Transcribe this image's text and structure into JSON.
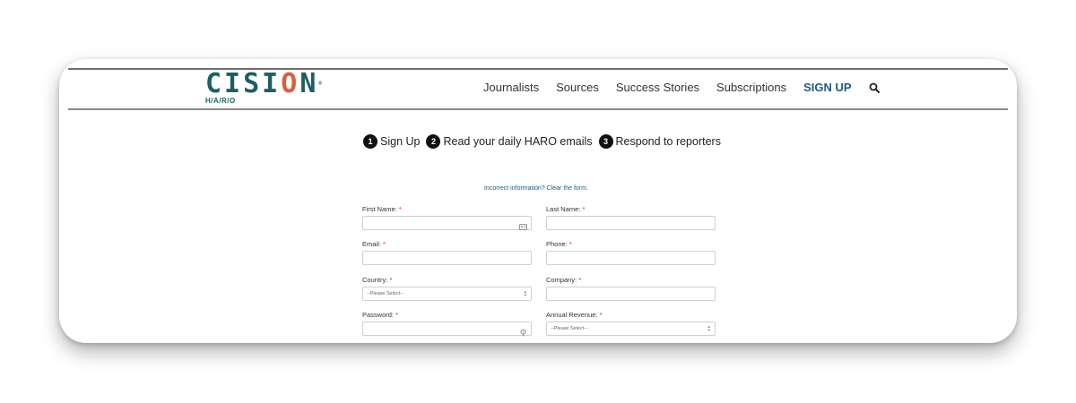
{
  "brand": {
    "word_start": "CISI",
    "word_o": "O",
    "word_end": "N",
    "trademark": "®",
    "subtitle": "H/A/R/O"
  },
  "nav": {
    "items": [
      "Journalists",
      "Sources",
      "Success Stories",
      "Subscriptions"
    ],
    "signup": "SIGN UP",
    "search_icon": "search-icon"
  },
  "steps": [
    {
      "num": "1",
      "label": "Sign Up"
    },
    {
      "num": "2",
      "label": "Read your daily HARO emails"
    },
    {
      "num": "3",
      "label": "Respond to reporters"
    }
  ],
  "form": {
    "clear_link": "Incorrect information? Clear the form.",
    "required_mark": "*",
    "first_name": {
      "label": "First Name:",
      "value": ""
    },
    "last_name": {
      "label": "Last Name:",
      "value": ""
    },
    "email": {
      "label": "Email:",
      "value": ""
    },
    "phone": {
      "label": "Phone:",
      "value": ""
    },
    "country": {
      "label": "Country:",
      "selected": "--Please Select--"
    },
    "company": {
      "label": "Company:",
      "value": ""
    },
    "password": {
      "label": "Password:",
      "value": ""
    },
    "annual_revenue": {
      "label": "Annual Revenue:",
      "selected": "--Please Select--"
    }
  },
  "colors": {
    "brand_teal": "#1e5f63",
    "brand_orange": "#d9603c",
    "link_blue": "#1e5a86",
    "required_red": "#cc1f1f"
  }
}
